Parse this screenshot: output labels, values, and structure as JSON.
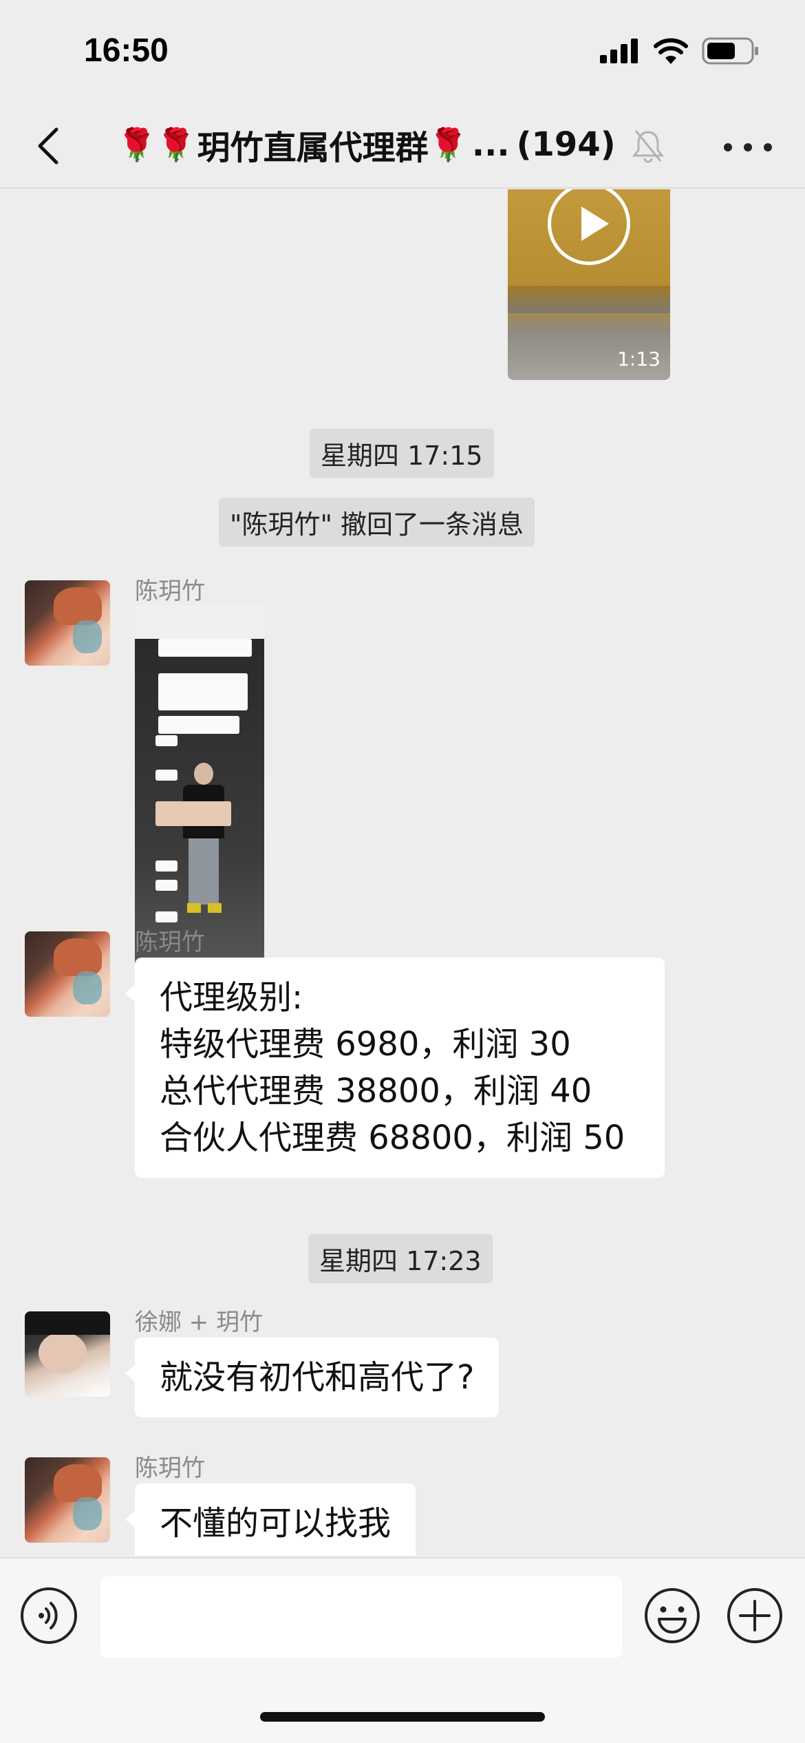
{
  "status_bar": {
    "time": "16:50",
    "icons": [
      "cellular-signal-icon",
      "wifi-icon",
      "battery-icon"
    ]
  },
  "header": {
    "back_icon": "chevron-left-icon",
    "title_prefix_emoji": "🌹🌹",
    "title_text": "玥竹直属代理群",
    "title_suffix_emoji": "🌹",
    "title_ellipsis": "...",
    "member_count": "(194)",
    "muted_icon": "bell-off-icon",
    "more_icon": "more-dots-icon"
  },
  "messages": {
    "video": {
      "duration": "1:13",
      "icon": "play-icon"
    },
    "timestamp_1": "星期四 17:15",
    "recall_notice": "\"陈玥竹\" 撤回了一条消息",
    "image_msg": {
      "sender": "陈玥竹"
    },
    "text_msg_1": {
      "sender": "陈玥竹",
      "lines": [
        "代理级别:",
        "特级代理费 6980，利润 30",
        "总代代理费 38800，利润 40",
        "合伙人代理费 68800，利润 50"
      ]
    },
    "timestamp_2": "星期四 17:23",
    "text_msg_2": {
      "sender": "徐娜 + 玥竹",
      "text": "就没有初代和高代了?"
    },
    "text_msg_3": {
      "sender": "陈玥竹",
      "text": "不懂的可以找我"
    }
  },
  "input_bar": {
    "voice_icon": "voice-input-icon",
    "input_value": "",
    "emoji_icon": "emoji-icon",
    "plus_icon": "plus-circle-icon"
  },
  "colors": {
    "background": "#ededed",
    "bubble": "#ffffff",
    "time_pill": "#dcdcdc",
    "sender_name": "#8a8a8a"
  }
}
